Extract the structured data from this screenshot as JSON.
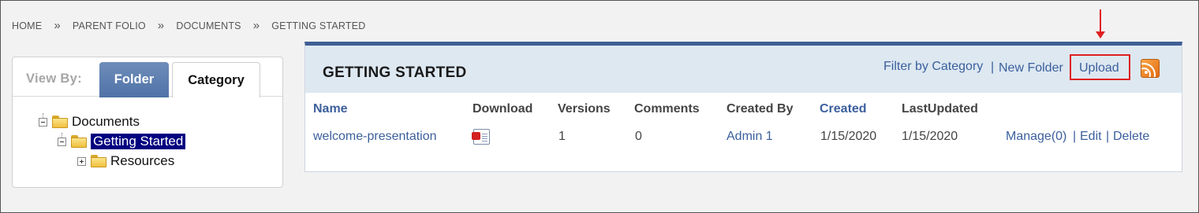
{
  "breadcrumb": {
    "items": [
      "HOME",
      "PARENT FOLIO",
      "DOCUMENTS",
      "GETTING STARTED"
    ],
    "separator": "»"
  },
  "left_panel": {
    "view_by_label": "View By:",
    "tabs": [
      {
        "label": "Folder",
        "active": true
      },
      {
        "label": "Category",
        "active": false
      }
    ],
    "tree": [
      {
        "label": "Documents",
        "state": "expanded",
        "level": 0
      },
      {
        "label": "Getting Started",
        "state": "expanded",
        "level": 1,
        "selected": true
      },
      {
        "label": "Resources",
        "state": "collapsed",
        "level": 2
      }
    ]
  },
  "panel": {
    "title": "GETTING STARTED",
    "actions": {
      "filter_by_category": "Filter by Category",
      "separator": "|",
      "new_folder": "New Folder",
      "upload": "Upload"
    },
    "rss_icon": "rss-feed-icon",
    "columns": [
      "Name",
      "Download",
      "Versions",
      "Comments",
      "Created By",
      "Created",
      "LastUpdated"
    ],
    "rows": [
      {
        "name": "welcome-presentation",
        "download_icon": "pdf-file-icon",
        "versions": "1",
        "comments": "0",
        "created_by": "Admin 1",
        "created": "1/15/2020",
        "last_updated": "1/15/2020",
        "manage": "Manage(0)",
        "edit": "Edit",
        "delete": "Delete",
        "row_separator": "|"
      }
    ]
  },
  "annotation": {
    "color": "#e02020",
    "target": "Upload"
  },
  "colors": {
    "link": "#3b5f9c",
    "header_bar": "#dde8f1",
    "panel_top_border": "#3f5f95",
    "active_tab": "#5a7bae",
    "tree_selection": "#000080"
  }
}
